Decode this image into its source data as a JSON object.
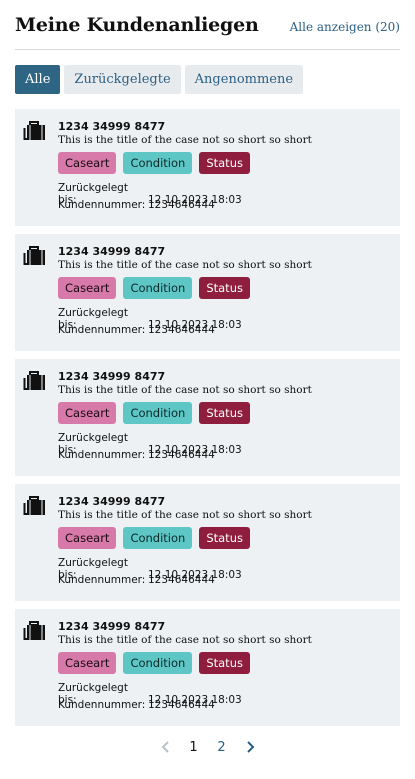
{
  "header": {
    "title": "Meine Kundenanliegen",
    "show_all": "Alle anzeigen (20)"
  },
  "tabs": [
    {
      "label": "Alle",
      "active": true
    },
    {
      "label": "Zurückgelegte",
      "active": false
    },
    {
      "label": "Angenommene",
      "active": false
    }
  ],
  "cards": [
    {
      "number": "1234 34999 8477",
      "title": "This is the title of the case not so short so short",
      "badges": {
        "caseart": "Caseart",
        "condition": "Condition",
        "status": "Status"
      },
      "deadline_label": "Zurückgelegt bis:",
      "deadline_value": "12.10.2023  18:03",
      "customer_label": "Kundennummer:",
      "customer_value": "1234646444"
    },
    {
      "number": "1234 34999 8477",
      "title": "This is the title of the case not so short so short",
      "badges": {
        "caseart": "Caseart",
        "condition": "Condition",
        "status": "Status"
      },
      "deadline_label": "Zurückgelegt bis:",
      "deadline_value": "12.10.2023  18:03",
      "customer_label": "Kundennummer:",
      "customer_value": "1234646444"
    },
    {
      "number": "1234 34999 8477",
      "title": "This is the title of the case not so short so short",
      "badges": {
        "caseart": "Caseart",
        "condition": "Condition",
        "status": "Status"
      },
      "deadline_label": "Zurückgelegt bis:",
      "deadline_value": "12.10.2023  18:03",
      "customer_label": "Kundennummer:",
      "customer_value": "1234646444"
    },
    {
      "number": "1234 34999 8477",
      "title": "This is the title of the case not so short so short",
      "badges": {
        "caseart": "Caseart",
        "condition": "Condition",
        "status": "Status"
      },
      "deadline_label": "Zurückgelegt bis:",
      "deadline_value": "12.10.2023  18:03",
      "customer_label": "Kundennummer:",
      "customer_value": "1234646444"
    },
    {
      "number": "1234 34999 8477",
      "title": "This is the title of the case not so short so short",
      "badges": {
        "caseart": "Caseart",
        "condition": "Condition",
        "status": "Status"
      },
      "deadline_label": "Zurückgelegt bis:",
      "deadline_value": "12.10.2023  18:03",
      "customer_label": "Kundennummer:",
      "customer_value": "1234646444"
    }
  ],
  "pagination": {
    "prev_icon": "chevron-left-icon",
    "pages": [
      "1",
      "2"
    ],
    "current": "1",
    "next_icon": "chevron-right-icon"
  },
  "icons": {
    "card_icon": "briefcase-icon"
  },
  "colors": {
    "accent": "#2e6584",
    "link": "#2b5f84",
    "caseart": "#d77aa9",
    "condition": "#5ec6c4",
    "status": "#8f1d3e",
    "card_bg": "#edf1f4"
  }
}
